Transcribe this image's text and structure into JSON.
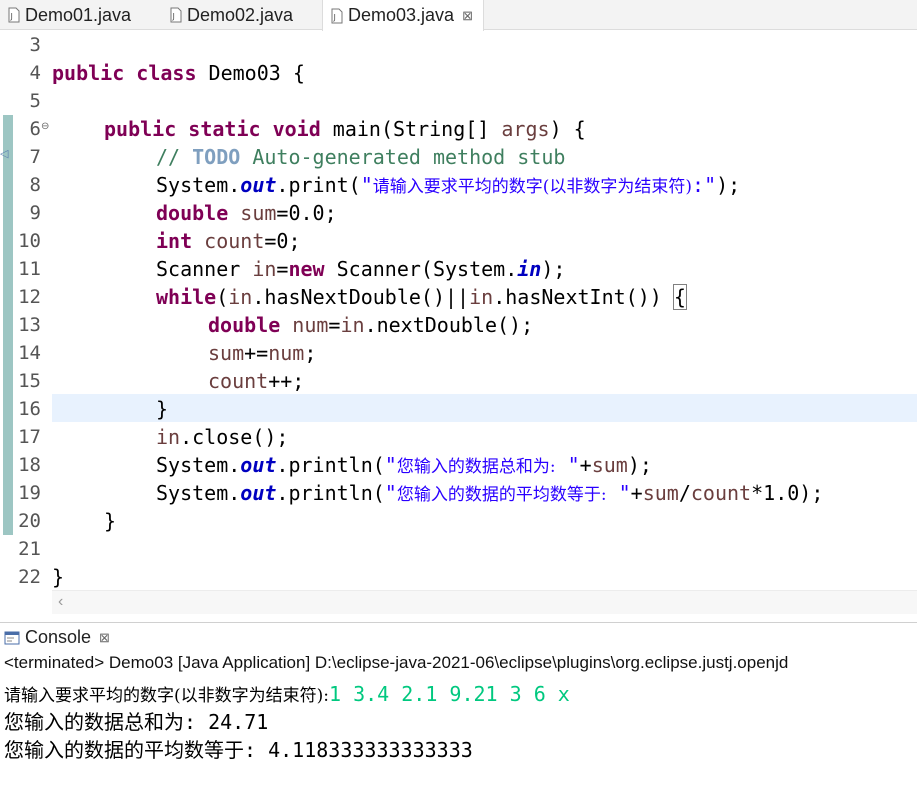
{
  "tabs": [
    {
      "label": "Demo01.java",
      "active": false
    },
    {
      "label": "Demo02.java",
      "active": false
    },
    {
      "label": "Demo03.java",
      "active": true,
      "close": "⊠"
    }
  ],
  "editor": {
    "line_numbers": [
      "3",
      "4",
      "5",
      "6",
      "7",
      "8",
      "9",
      "10",
      "11",
      "12",
      "13",
      "14",
      "15",
      "16",
      "17",
      "18",
      "19",
      "20",
      "21",
      "22"
    ],
    "code": {
      "l4": {
        "kw1": "public",
        "kw2": "class",
        "rest": " Demo03 {"
      },
      "l6": {
        "kw1": "public",
        "kw2": "static",
        "kw3": "void",
        "rest1": " main(String[] ",
        "var": "args",
        "rest2": ") {"
      },
      "l7": {
        "slash": "// ",
        "todo": "TODO",
        "text": " Auto-generated method stub"
      },
      "l8": {
        "pre": "System.",
        "fld": "out",
        "mid": ".print(",
        "q1": "\"",
        "cn": "请输入要求平均的数字(以非数字为结束符)",
        "q2": ":\"",
        "end": ");"
      },
      "l9": {
        "kw": "double",
        "var": "sum",
        "rest": "=0.0;"
      },
      "l10": {
        "kw": "int",
        "var": "count",
        "rest": "=0;"
      },
      "l11": {
        "pre": "Scanner ",
        "var": "in",
        "eq": "=",
        "kw": "new",
        "mid": " Scanner(System.",
        "fld": "in",
        "end": ");"
      },
      "l12": {
        "kw": "while",
        "p1": "(",
        "var1": "in",
        "m1": ".hasNextDouble()||",
        "var2": "in",
        "m2": ".hasNextInt()) ",
        "brace": "{"
      },
      "l13": {
        "kw": "double",
        "var1": "num",
        "eq": "=",
        "var2": "in",
        "rest": ".nextDouble();"
      },
      "l14": {
        "var1": "sum",
        "op": "+=",
        "var2": "num",
        "end": ";"
      },
      "l15": {
        "var": "count",
        "end": "++;"
      },
      "l16": {
        "text": "}"
      },
      "l17": {
        "var": "in",
        "rest": ".close();"
      },
      "l18": {
        "pre": "System.",
        "fld": "out",
        "mid": ".println(",
        "q1": "\"",
        "cn": "您输入的数据总和为:",
        "q2": " \"",
        "plus": "+",
        "var": "sum",
        "end": ");"
      },
      "l19": {
        "pre": "System.",
        "fld": "out",
        "mid": ".println(",
        "q1": "\"",
        "cn": "您输入的数据的平均数等于:",
        "q2": " \"",
        "plus": "+",
        "var1": "sum",
        "slash": "/",
        "var2": "count",
        "end": "*1.0);"
      },
      "l20": {
        "text": "}"
      },
      "l22": {
        "text": "}"
      }
    }
  },
  "console": {
    "tab_label": "Console",
    "tab_close": "⊠",
    "status": "<terminated> Demo03 [Java Application] D:\\eclipse-java-2021-06\\eclipse\\plugins\\org.eclipse.justj.openjd",
    "output": [
      {
        "prompt": "请输入要求平均的数字(以非数字为结束符):",
        "input": "1 3.4 2.1 9.21 3 6 x"
      },
      {
        "text": "您输入的数据总和为: 24.71"
      },
      {
        "text": "您输入的数据的平均数等于: 4.118333333333333"
      }
    ]
  },
  "colors": {
    "keyword": "#7f0055",
    "local_var": "#6a3e3e",
    "field": "#0000c0",
    "comment": "#3f7f5f",
    "string": "#2a00ff",
    "console_input": "#00c87f",
    "current_line": "#e8f2fe"
  }
}
